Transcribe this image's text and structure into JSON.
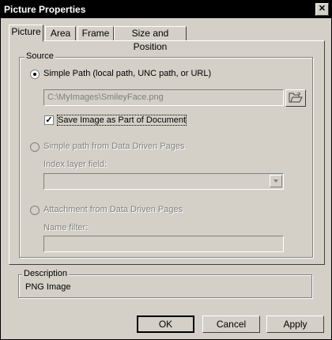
{
  "window": {
    "title": "Picture Properties",
    "close_glyph": "✕"
  },
  "tabs": [
    {
      "label": "Picture",
      "active": true
    },
    {
      "label": "Area",
      "active": false
    },
    {
      "label": "Frame",
      "active": false
    },
    {
      "label": "Size and Position",
      "active": false
    }
  ],
  "source": {
    "group_label": "Source",
    "simple_path_label": "Simple Path (local path, UNC path, or URL)",
    "path_value": "C:\\MyImages\\SmileyFace.png",
    "save_image_label": "Save Image as Part of Document",
    "save_image_checked": true,
    "ddp_path_label": "Simple path from Data Driven Pages",
    "index_layer_label": "Index layer field:",
    "attachment_label": "Attachment from Data Driven Pages",
    "name_filter_label": "Name filter:",
    "name_filter_value": ""
  },
  "description": {
    "group_label": "Description",
    "text": "PNG Image"
  },
  "buttons": {
    "ok": "OK",
    "cancel": "Cancel",
    "apply": "Apply"
  }
}
